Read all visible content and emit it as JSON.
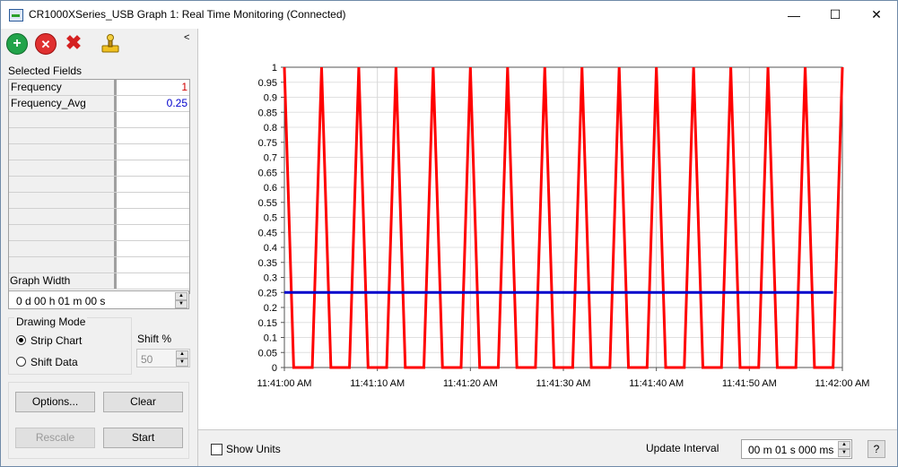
{
  "window": {
    "title": "CR1000XSeries_USB Graph 1: Real Time Monitoring (Connected)",
    "controls": {
      "minimize": "—",
      "maximize": "☐",
      "close": "✕"
    }
  },
  "toolbar": {
    "icons": [
      "add-icon",
      "remove-icon",
      "delete-all-icon",
      "joystick-icon"
    ],
    "collapse": "<"
  },
  "selected_fields": {
    "label": "Selected Fields",
    "rows": [
      {
        "name": "Frequency",
        "value": "1",
        "color": "#d00000"
      },
      {
        "name": "Frequency_Avg",
        "value": "0.25",
        "color": "#0000cc"
      },
      {
        "name": "",
        "value": ""
      },
      {
        "name": "",
        "value": ""
      },
      {
        "name": "",
        "value": ""
      },
      {
        "name": "",
        "value": ""
      },
      {
        "name": "",
        "value": ""
      },
      {
        "name": "",
        "value": ""
      },
      {
        "name": "",
        "value": ""
      },
      {
        "name": "",
        "value": ""
      },
      {
        "name": "",
        "value": ""
      },
      {
        "name": "",
        "value": ""
      },
      {
        "name": "",
        "value": ""
      }
    ]
  },
  "graph_width": {
    "label": "Graph Width",
    "value": "0 d 00 h 01 m 00 s"
  },
  "drawing_mode": {
    "label": "Drawing Mode",
    "options": [
      "Strip Chart",
      "Shift Data"
    ],
    "selected": "Strip Chart"
  },
  "shift": {
    "label": "Shift %",
    "value": "50"
  },
  "buttons": {
    "options": "Options...",
    "clear": "Clear",
    "rescale": "Rescale",
    "start": "Start"
  },
  "bottom": {
    "show_units": "Show Units",
    "update_interval_label": "Update Interval",
    "update_interval_value": "00 m 01 s 000 ms",
    "help": "?"
  },
  "chart_data": {
    "type": "line",
    "xlabel": "",
    "ylabel": "",
    "ylim": [
      0,
      1
    ],
    "y_ticks": [
      "1",
      "0.95",
      "0.9",
      "0.85",
      "0.8",
      "0.75",
      "0.7",
      "0.65",
      "0.6",
      "0.55",
      "0.5",
      "0.45",
      "0.4",
      "0.35",
      "0.3",
      "0.25",
      "0.2",
      "0.15",
      "0.1",
      "0.05",
      "0"
    ],
    "x_ticks": [
      "11:41:00 AM",
      "11:41:10 AM",
      "11:41:20 AM",
      "11:41:30 AM",
      "11:41:40 AM",
      "11:41:50 AM",
      "11:42:00 AM"
    ],
    "x_range": [
      "11:41:00 AM",
      "11:42:00 AM"
    ],
    "grid": true,
    "series": [
      {
        "name": "Frequency",
        "color": "#ff0000",
        "x": [
          "11:41:00 AM",
          "11:41:01 AM",
          "11:41:03 AM",
          "11:41:04 AM",
          "11:41:05 AM",
          "11:41:07 AM",
          "11:41:08 AM",
          "11:41:09 AM",
          "11:41:11 AM",
          "11:41:12 AM",
          "11:41:13 AM",
          "11:41:15 AM",
          "11:41:16 AM",
          "11:41:17 AM",
          "11:41:19 AM",
          "11:41:20 AM",
          "11:41:21 AM",
          "11:41:23 AM",
          "11:41:24 AM",
          "11:41:25 AM",
          "11:41:27 AM",
          "11:41:28 AM",
          "11:41:29 AM",
          "11:41:31 AM",
          "11:41:32 AM",
          "11:41:33 AM",
          "11:41:35 AM",
          "11:41:36 AM",
          "11:41:37 AM",
          "11:41:39 AM",
          "11:41:40 AM",
          "11:41:41 AM",
          "11:41:43 AM",
          "11:41:44 AM",
          "11:41:45 AM",
          "11:41:47 AM",
          "11:41:48 AM",
          "11:41:49 AM",
          "11:41:51 AM",
          "11:41:52 AM",
          "11:41:53 AM",
          "11:41:55 AM",
          "11:41:56 AM",
          "11:41:57 AM",
          "11:41:59 AM",
          "11:42:00 AM"
        ],
        "values": [
          1,
          0,
          0,
          1,
          0,
          0,
          1,
          0,
          0,
          1,
          0,
          0,
          1,
          0,
          0,
          1,
          0,
          0,
          1,
          0,
          0,
          1,
          0,
          0,
          1,
          0,
          0,
          1,
          0,
          0,
          1,
          0,
          0,
          1,
          0,
          0,
          1,
          0,
          0,
          1,
          0,
          0,
          1,
          0,
          0,
          1
        ]
      },
      {
        "name": "Frequency_Avg",
        "color": "#0000cc",
        "x": [
          "11:41:00 AM",
          "11:41:59 AM"
        ],
        "values": [
          0.25,
          0.25
        ]
      }
    ]
  }
}
